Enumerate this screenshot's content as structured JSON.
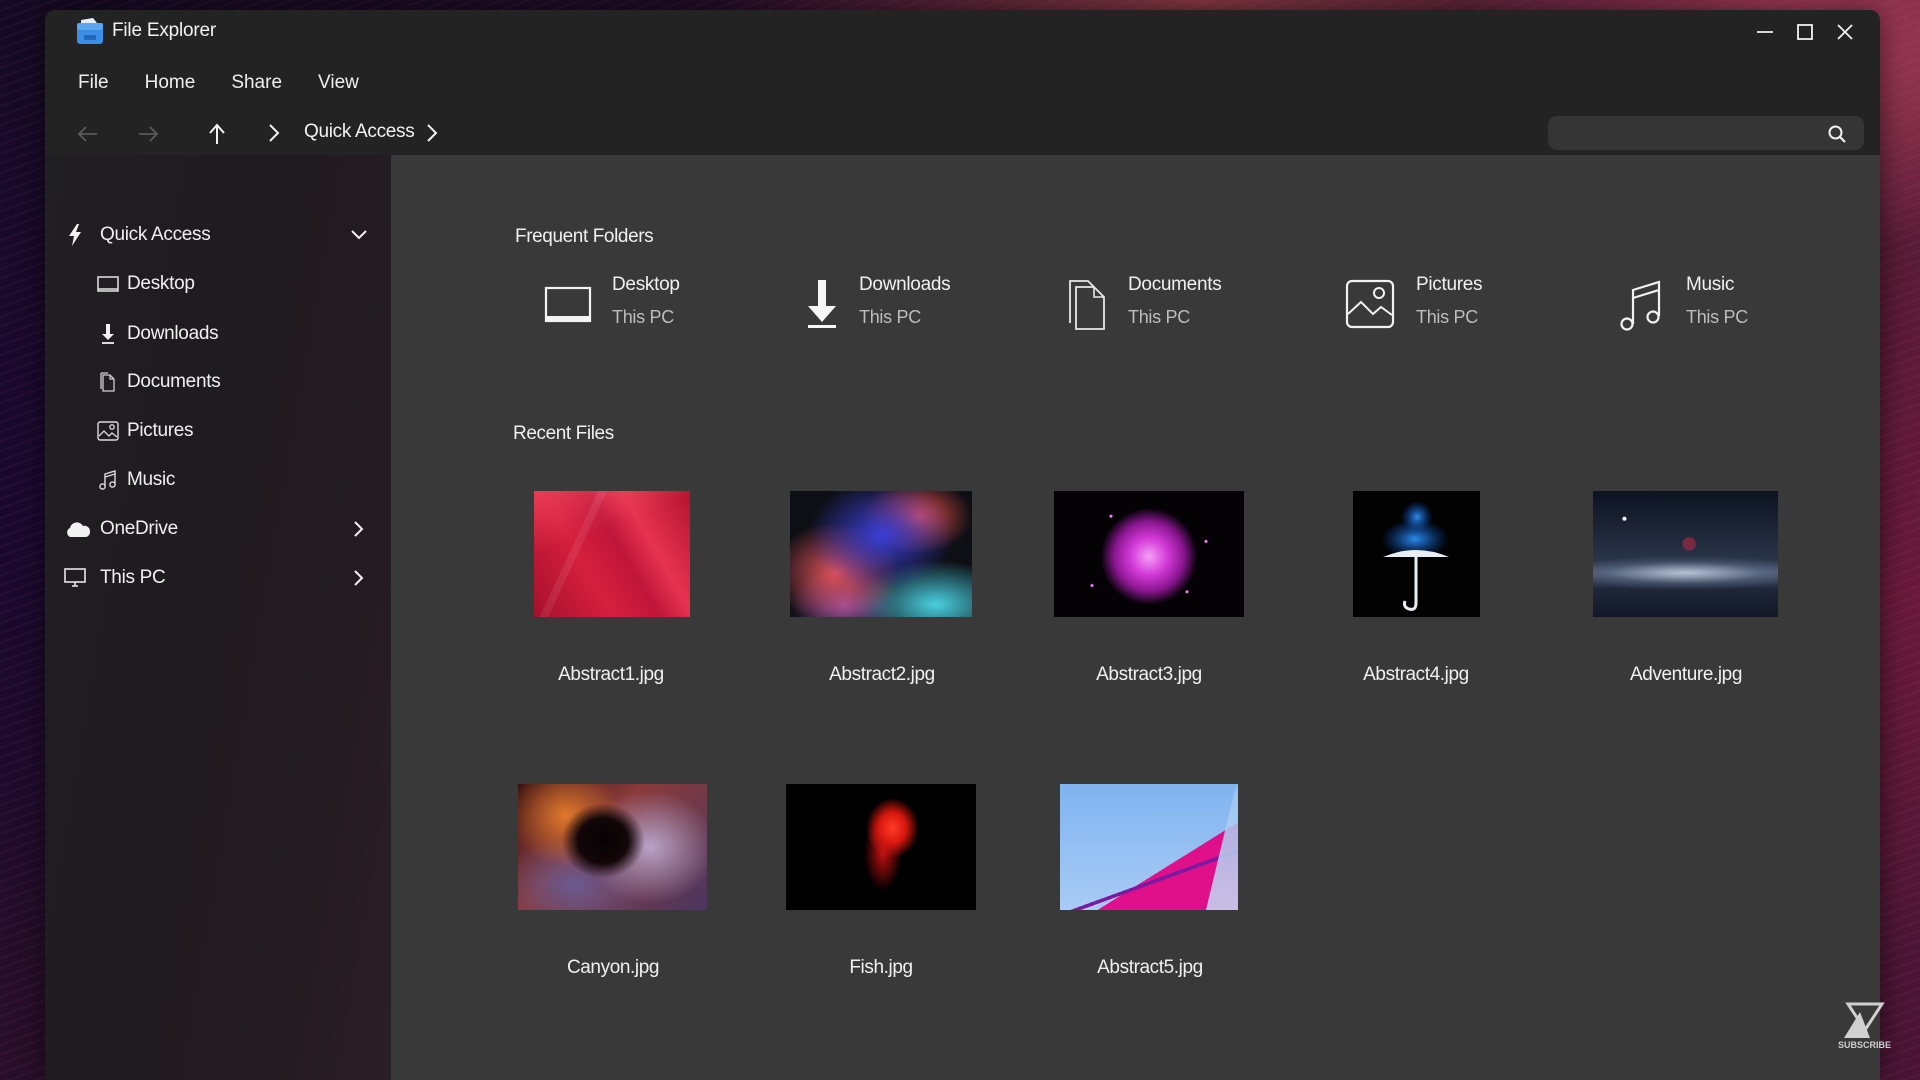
{
  "window": {
    "title": "File Explorer",
    "controls": {
      "minimize": "minimize",
      "maximize": "maximize",
      "close": "close"
    }
  },
  "menu": {
    "items": [
      {
        "label": "File"
      },
      {
        "label": "Home"
      },
      {
        "label": "Share"
      },
      {
        "label": "View"
      }
    ]
  },
  "toolbar": {
    "breadcrumb": [
      "Quick Access"
    ],
    "search": {
      "value": "",
      "placeholder": ""
    }
  },
  "sidebar": {
    "items": [
      {
        "label": "Quick Access",
        "icon": "lightning-icon",
        "level": "top",
        "expander": "chevron-down",
        "expanded": true
      },
      {
        "label": "Desktop",
        "icon": "desktop-icon",
        "level": "sub"
      },
      {
        "label": "Downloads",
        "icon": "download-icon",
        "level": "sub"
      },
      {
        "label": "Documents",
        "icon": "documents-icon",
        "level": "sub"
      },
      {
        "label": "Pictures",
        "icon": "pictures-icon",
        "level": "sub"
      },
      {
        "label": "Music",
        "icon": "music-icon",
        "level": "sub"
      },
      {
        "label": "OneDrive",
        "icon": "cloud-icon",
        "level": "top",
        "expander": "chevron-right",
        "expanded": false
      },
      {
        "label": "This PC",
        "icon": "monitor-icon",
        "level": "top",
        "expander": "chevron-right",
        "expanded": false
      }
    ]
  },
  "main": {
    "frequent_title": "Frequent Folders",
    "frequent_folders": [
      {
        "name": "Desktop",
        "location": "This PC",
        "icon": "desktop-icon"
      },
      {
        "name": "Downloads",
        "location": "This PC",
        "icon": "download-icon"
      },
      {
        "name": "Documents",
        "location": "This PC",
        "icon": "documents-icon"
      },
      {
        "name": "Pictures",
        "location": "This PC",
        "icon": "pictures-icon"
      },
      {
        "name": "Music",
        "location": "This PC",
        "icon": "music-icon"
      }
    ],
    "recent_title": "Recent Files",
    "recent_files": [
      {
        "name": "Abstract1.jpg",
        "thumb": "red abstract layers"
      },
      {
        "name": "Abstract2.jpg",
        "thumb": "colored smoke"
      },
      {
        "name": "Abstract3.jpg",
        "thumb": "magenta flower on black"
      },
      {
        "name": "Abstract4.jpg",
        "thumb": "umbrella with blue smoke"
      },
      {
        "name": "Adventure.jpg",
        "thumb": "hot air balloon over misty sea"
      },
      {
        "name": "Canyon.jpg",
        "thumb": "slot canyon"
      },
      {
        "name": "Fish.jpg",
        "thumb": "red betta fish"
      },
      {
        "name": "Abstract5.jpg",
        "thumb": "pink building against blue sky"
      }
    ]
  },
  "watermark": {
    "label": "SUBSCRIBE"
  },
  "colors": {
    "window_bg": "#232323",
    "main_bg": "#393939",
    "sidebar_bg": "#1f1c1f",
    "search_bg": "#353535",
    "app_icon_blue": "#3a8ee6",
    "text": "#f0f0f0",
    "subtext": "#bdbdbd"
  }
}
